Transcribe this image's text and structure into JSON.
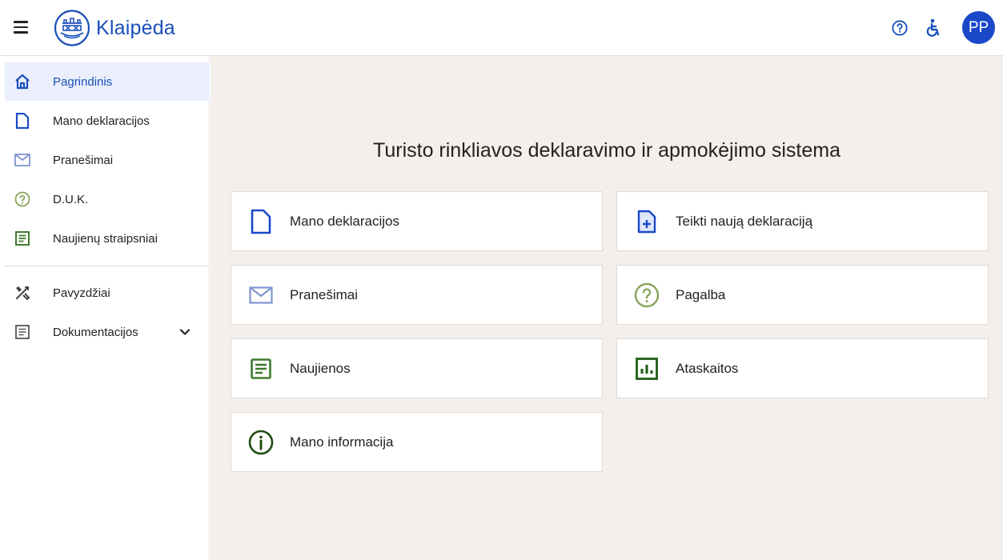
{
  "header": {
    "logo_text": "Klaipėda",
    "avatar_initials": "PP",
    "icons": [
      "menu-icon",
      "help-icon",
      "accessibility-icon"
    ]
  },
  "sidebar": {
    "items": [
      {
        "label": "Pagrindinis",
        "icon": "home-icon",
        "active": true
      },
      {
        "label": "Mano deklaracijos",
        "icon": "document-icon"
      },
      {
        "label": "Pranešimai",
        "icon": "mail-icon"
      },
      {
        "label": "D.U.K.",
        "icon": "question-icon"
      },
      {
        "label": "Naujienų straipsniai",
        "icon": "article-icon"
      },
      {
        "label": "Pavyzdžiai",
        "icon": "tools-icon"
      },
      {
        "label": "Dokumentacijos",
        "icon": "docs-icon",
        "expandable": true
      }
    ]
  },
  "main": {
    "title": "Turisto rinkliavos deklaravimo ir apmokėjimo sistema",
    "cards": [
      {
        "label": "Mano deklaracijos",
        "icon": "document-icon"
      },
      {
        "label": "Teikti naują deklaraciją",
        "icon": "add-document-icon"
      },
      {
        "label": "Pranešimai",
        "icon": "mail-icon"
      },
      {
        "label": "Pagalba",
        "icon": "question-icon"
      },
      {
        "label": "Naujienos",
        "icon": "article-icon"
      },
      {
        "label": "Ataskaitos",
        "icon": "report-icon"
      },
      {
        "label": "Mano informacija",
        "icon": "info-icon"
      }
    ]
  },
  "colors": {
    "brand_blue": "#1a4fb9",
    "avatar_bg": "#1a48c9",
    "main_bg": "#f4efeb",
    "active_nav_bg": "#eaeffb",
    "green_icon": "#3e7b2e",
    "mail_icon": "#7f95cf",
    "question_icon": "#8aa45a",
    "info_icon": "#1e4d12"
  }
}
